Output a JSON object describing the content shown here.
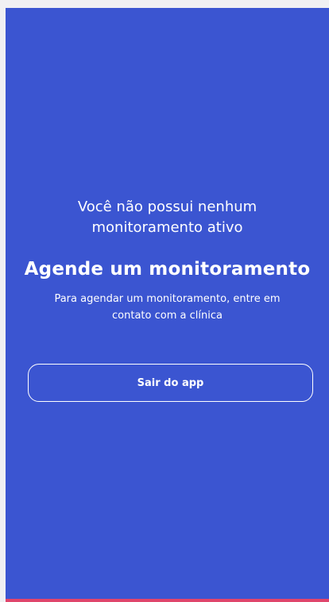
{
  "empty_state": {
    "status_line_1": "Você não possui nenhum",
    "status_line_2": "monitoramento ativo",
    "title": "Agende um monitoramento",
    "description_line_1": "Para agendar um monitoramento, entre em",
    "description_line_2": "contato com a clínica"
  },
  "actions": {
    "exit_label": "Sair do app"
  },
  "colors": {
    "background": "#3b55d1",
    "accent_bar": "#e0456b",
    "text": "#ffffff"
  }
}
